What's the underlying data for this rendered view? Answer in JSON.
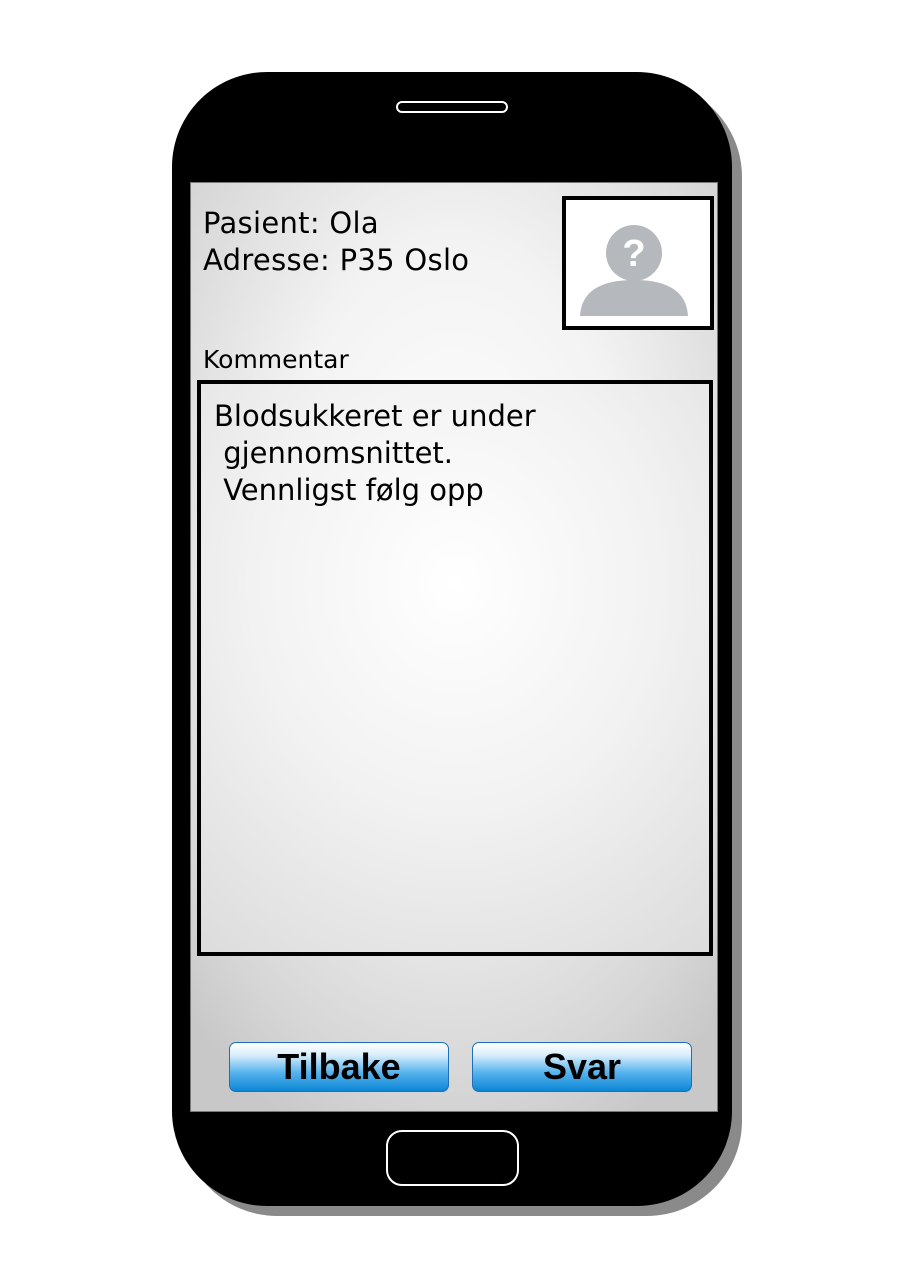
{
  "patient": {
    "name_line": "Pasient: Ola",
    "address_line": "Adresse: P35 Oslo"
  },
  "avatar": {
    "icon": "user-placeholder-icon",
    "glyph": "?"
  },
  "comment": {
    "label": "Kommentar",
    "text": "Blodsukkeret er under\n gjennomsnittet.\n Vennligst følg opp"
  },
  "buttons": {
    "back_label": "Tilbake",
    "reply_label": "Svar"
  },
  "colors": {
    "button_accent": "#0b86d6",
    "phone_body": "#000000",
    "avatar_icon": "#b5b8bc"
  }
}
